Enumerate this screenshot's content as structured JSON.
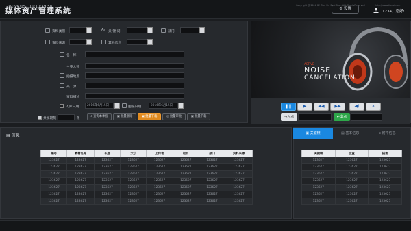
{
  "app": {
    "title": "媒体资产管理系统",
    "settings_label": "设置",
    "user_label": "1234，您好!"
  },
  "search": {
    "field_category": "资料类别",
    "field_keyword": "关 键 词",
    "field_dept": "部门",
    "field_source": "资料来源",
    "field_other": "其他信息",
    "field_name": "名　称",
    "field_person": "主要人物",
    "field_location": "拍摄地点",
    "field_origin": "来　源",
    "field_desc": "资料描述",
    "field_date": "入库日期",
    "date_from": "2016年6月15日",
    "date_sep": "拍摄日期",
    "date_to": "2016年6月15日",
    "shared_label": "共享期制",
    "shared_unit": "条",
    "btn_query": "查询本季视",
    "btn_delete": "批量删除",
    "btn_download": "批量下载",
    "btn_approve": "批量审批",
    "btn_export": "批量下载"
  },
  "media": {
    "brand_small": "ACTIVE",
    "headline1": "NOISE",
    "headline2": "CANCELATION",
    "in_label": "入点",
    "out_label": "出点"
  },
  "info": {
    "section_title": "信息",
    "columns": [
      "编号",
      "素材名称",
      "长度",
      "大小",
      "上传者",
      "栏目",
      "部门",
      "资料来源"
    ],
    "rows": [
      [
        "123627",
        "123627",
        "123627",
        "123627",
        "123627",
        "123627",
        "123627",
        "123627"
      ],
      [
        "123627",
        "123627",
        "123627",
        "123627",
        "123627",
        "123627",
        "123627",
        "123627"
      ],
      [
        "123627",
        "123627",
        "123627",
        "123627",
        "123627",
        "123627",
        "123627",
        "123627"
      ],
      [
        "123627",
        "123627",
        "123627",
        "123627",
        "123627",
        "123627",
        "123627",
        "123627"
      ],
      [
        "123627",
        "123627",
        "123627",
        "123627",
        "123627",
        "123627",
        "123627",
        "123627"
      ],
      [
        "123627",
        "123627",
        "123627",
        "123627",
        "123627",
        "123627",
        "123627",
        "123627"
      ],
      [
        "123627",
        "123627",
        "123627",
        "123627",
        "123627",
        "123627",
        "123627",
        "123627"
      ]
    ]
  },
  "keywords": {
    "tabs": [
      "关键帧",
      "基本信息",
      "附件信息"
    ],
    "columns": [
      "关键帧",
      "位置",
      "描述"
    ],
    "rows": [
      [
        "123627",
        "123627",
        "123627"
      ],
      [
        "123627",
        "123627",
        "123627"
      ],
      [
        "123627",
        "123627",
        "123627"
      ],
      [
        "123627",
        "123627",
        "123627"
      ],
      [
        "123627",
        "123627",
        "123627"
      ],
      [
        "123627",
        "123627",
        "123627"
      ],
      [
        "123627",
        "123627",
        "123627"
      ]
    ]
  },
  "status": {
    "datetime": "2016/6/15　10:10:19:58",
    "copyright": "Copyright @ 2016 BY Tian Shi Shui Bao., ALL RightsReserved",
    "website": "http://www.tianoi.com"
  },
  "colors": {
    "accent": "#1a88e0",
    "orange": "#e08a1e",
    "green": "#2ea84a"
  }
}
